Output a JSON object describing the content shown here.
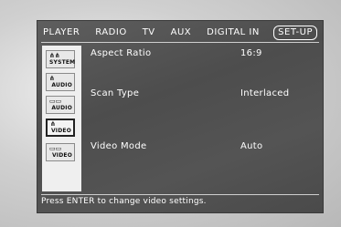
{
  "tabs": [
    "PLAYER",
    "RADIO",
    "TV",
    "AUX",
    "DIGITAL IN",
    "SET-UP"
  ],
  "active_tab": "SET-UP",
  "sidebar": {
    "items": [
      {
        "label": "SYSTEM",
        "icon": "system-icon",
        "glyph": "⋔⋔"
      },
      {
        "label": "AUDIO",
        "icon": "speaker-icon",
        "glyph": "⋔"
      },
      {
        "label": "AUDIO",
        "icon": "audio-io-icon",
        "glyph": "▭▭"
      },
      {
        "label": "VIDEO",
        "icon": "video-icon",
        "glyph": "⋔"
      },
      {
        "label": "VIDEO",
        "icon": "video-io-icon",
        "glyph": "▭▭"
      }
    ],
    "active_index": 3
  },
  "settings": [
    {
      "label": "Aspect Ratio",
      "value": "16:9"
    },
    {
      "label": "Scan Type",
      "value": "Interlaced"
    },
    {
      "label": "Video Mode",
      "value": "Auto"
    }
  ],
  "status_text": "Press ENTER to change video settings."
}
